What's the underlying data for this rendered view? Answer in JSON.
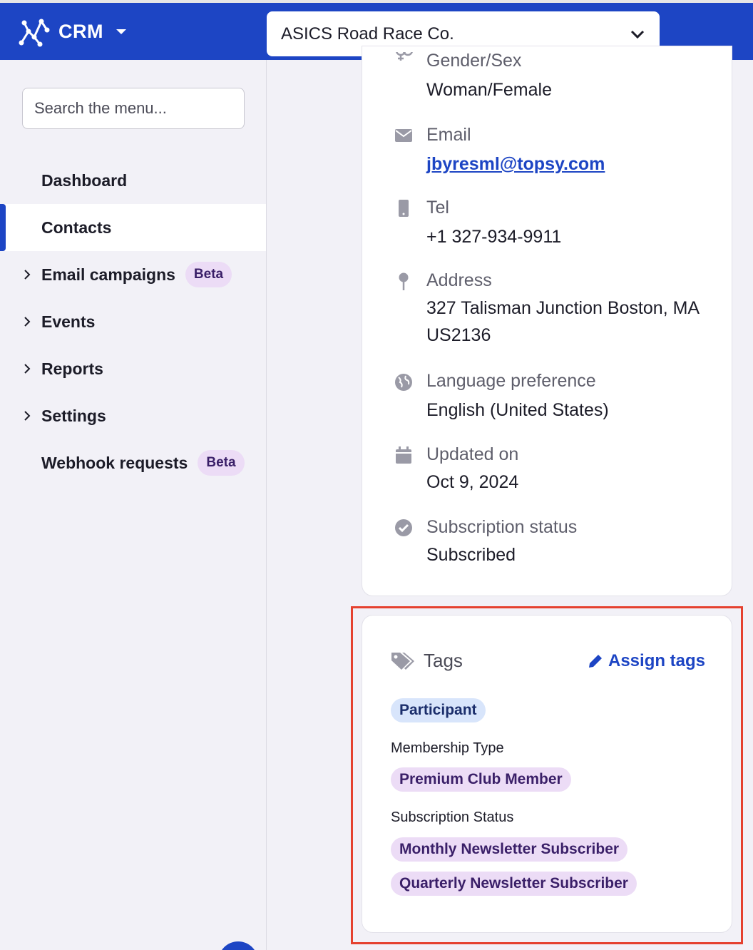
{
  "header": {
    "app_name": "CRM",
    "org_select": "ASICS Road Race Co.",
    "brand_color": "#1d45c4"
  },
  "sidebar": {
    "search_placeholder": "Search the menu...",
    "items": [
      {
        "label": "Dashboard",
        "expandable": false
      },
      {
        "label": "Contacts",
        "expandable": false,
        "active": true
      },
      {
        "label": "Email campaigns",
        "expandable": true,
        "badge": "Beta"
      },
      {
        "label": "Events",
        "expandable": true
      },
      {
        "label": "Reports",
        "expandable": true
      },
      {
        "label": "Settings",
        "expandable": true
      },
      {
        "label": "Webhook requests",
        "expandable": false,
        "badge": "Beta"
      }
    ]
  },
  "contact": {
    "gender": {
      "label": "Gender/Sex",
      "value": "Woman/Female"
    },
    "email": {
      "label": "Email",
      "value": "jbyresml@topsy.com"
    },
    "tel": {
      "label": "Tel",
      "value": "+1 327-934-9911"
    },
    "address": {
      "label": "Address",
      "value": "327 Talisman Junction Boston, MA US2136"
    },
    "language": {
      "label": "Language preference",
      "value": "English (United States)"
    },
    "updated": {
      "label": "Updated on",
      "value": "Oct 9, 2024"
    },
    "subscription": {
      "label": "Subscription status",
      "value": "Subscribed"
    }
  },
  "tags": {
    "title": "Tags",
    "assign_label": "Assign tags",
    "participant_tag": "Participant",
    "membership_label": "Membership Type",
    "membership_tags": [
      "Premium Club Member"
    ],
    "subscription_label": "Subscription Status",
    "subscription_tags": [
      "Monthly Newsletter Subscriber",
      "Quarterly Newsletter Subscriber"
    ],
    "highlight_color": "#e5412f"
  }
}
